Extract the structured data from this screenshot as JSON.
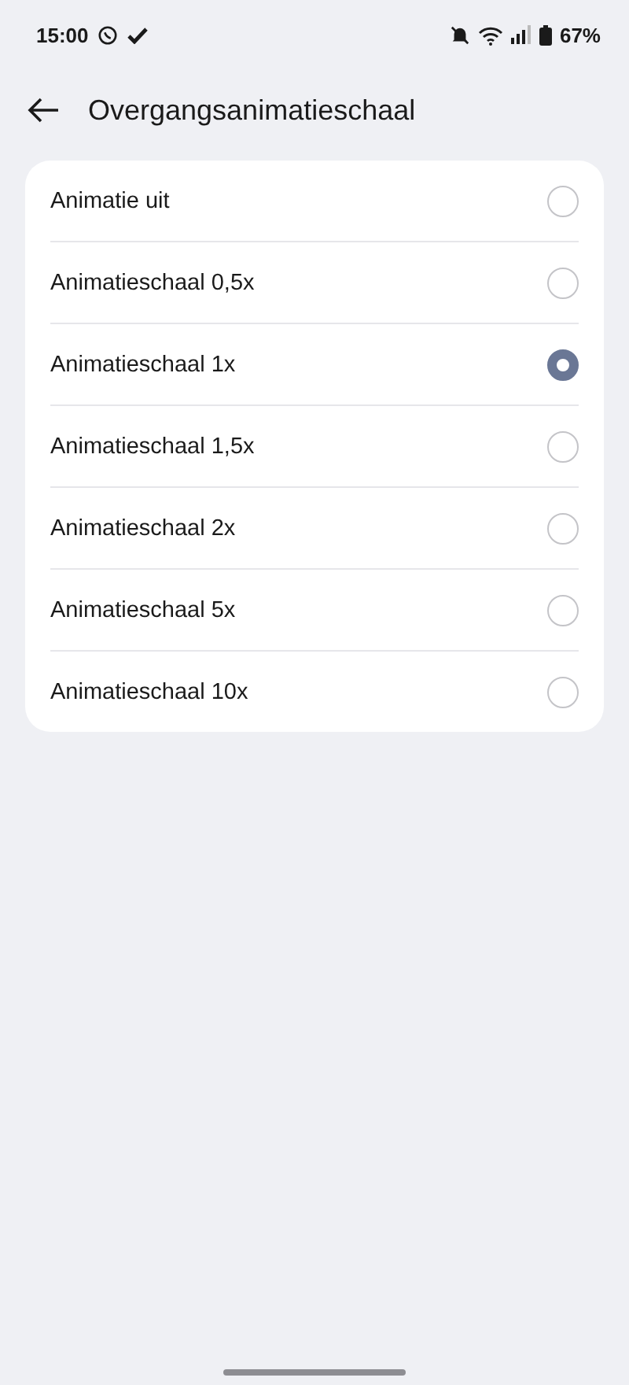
{
  "status_bar": {
    "time": "15:00",
    "battery": "67%"
  },
  "header": {
    "title": "Overgangsanimatieschaal"
  },
  "options": [
    {
      "label": "Animatie uit",
      "selected": false
    },
    {
      "label": "Animatieschaal 0,5x",
      "selected": false
    },
    {
      "label": "Animatieschaal 1x",
      "selected": true
    },
    {
      "label": "Animatieschaal 1,5x",
      "selected": false
    },
    {
      "label": "Animatieschaal 2x",
      "selected": false
    },
    {
      "label": "Animatieschaal 5x",
      "selected": false
    },
    {
      "label": "Animatieschaal 10x",
      "selected": false
    }
  ]
}
